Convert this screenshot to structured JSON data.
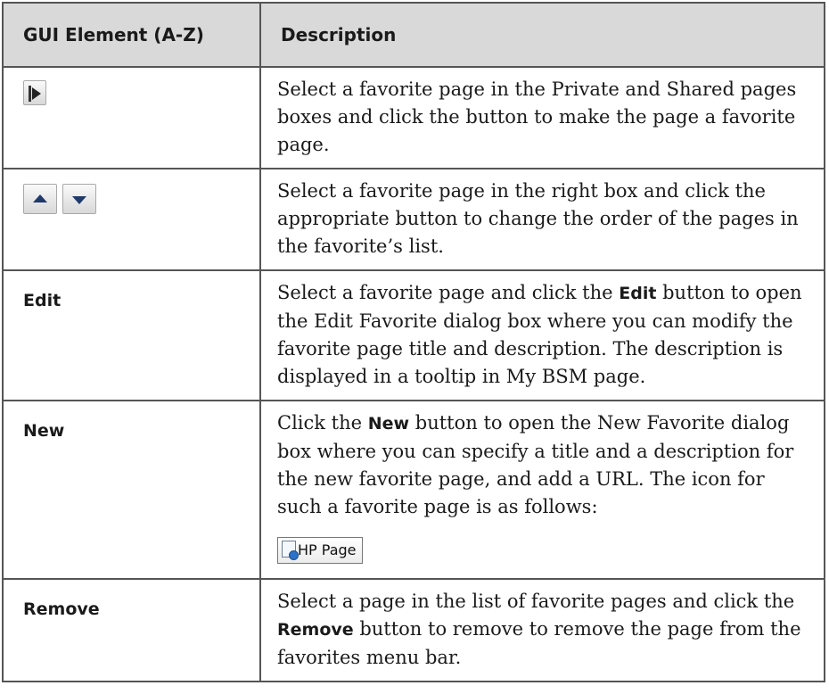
{
  "table": {
    "header": {
      "col1": "GUI Element (A-Z)",
      "col2": "Description"
    },
    "rows": [
      {
        "icon": "move-right-arrow-icon",
        "desc": "Select a favorite page in the Private and Shared pages boxes and click the button to make the page a favorite page."
      },
      {
        "icons": [
          "move-up-icon",
          "move-down-icon"
        ],
        "desc": "Select a favorite page in the right box and click the appropriate button to change the order of the pages in the favorite’s list."
      },
      {
        "label": "Edit",
        "desc_pre": "Select a favorite page and click the ",
        "desc_bold": "Edit",
        "desc_post": " button to open the Edit Favorite dialog box where you can modify the favorite page title and description. The description is displayed in a tooltip in My BSM page."
      },
      {
        "label": "New",
        "desc_pre": "Click the ",
        "desc_bold": "New",
        "desc_post": " button to open the New Favorite dialog box where you can specify a title and a description for the new favorite page, and add a URL. The icon for such a favorite page is as follows:",
        "sample_icon": "hp-page-icon",
        "sample_label": "HP Page"
      },
      {
        "label": "Remove",
        "desc_pre": "Select a page in the list of favorite pages and click the ",
        "desc_bold": "Remove",
        "desc_post": " button to remove to remove the page from the favorites menu bar."
      }
    ]
  }
}
